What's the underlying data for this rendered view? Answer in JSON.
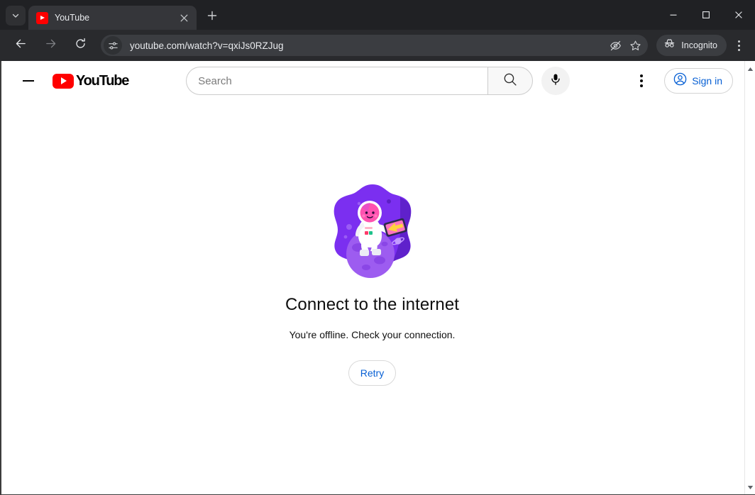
{
  "browser": {
    "tab_search_icon": "chevron-down-icon",
    "tabs": [
      {
        "title": "YouTube",
        "favicon": "youtube-favicon",
        "close_icon": "close-icon",
        "active": true
      }
    ],
    "new_tab_label": "+",
    "window_controls": {
      "minimize": "minimize-icon",
      "maximize": "maximize-icon",
      "close": "close-icon"
    },
    "toolbar": {
      "back_icon": "back-arrow-icon",
      "forward_icon": "forward-arrow-icon",
      "reload_icon": "reload-icon",
      "site_settings_icon": "tune-sliders-icon",
      "url": "youtube.com/watch?v=qxiJs0RZJug",
      "tracking_protection_icon": "eye-slash-icon",
      "bookmark_icon": "star-icon",
      "incognito_label": "Incognito",
      "incognito_icon": "incognito-hat-icon",
      "menu_icon": "three-dots-vertical-icon"
    },
    "colors": {
      "tabstrip_bg": "#202124",
      "active_tab_bg": "#35363a",
      "toolbar_bg": "#292a2d",
      "omnibox_bg": "#3b3d41",
      "toolbar_text": "#e8eaed"
    }
  },
  "youtube": {
    "header": {
      "menu_icon": "hamburger-menu-icon",
      "logo_text": "YouTube",
      "logo_icon": "youtube-play-icon",
      "search_placeholder": "Search",
      "search_value": "",
      "search_icon": "search-icon",
      "mic_icon": "microphone-icon",
      "settings_icon": "three-dots-vertical-icon",
      "sign_in_label": "Sign in",
      "sign_in_icon": "account-circle-icon"
    },
    "offline": {
      "illustration": "astronaut-on-planet-illustration",
      "title": "Connect to the internet",
      "subtitle": "You're offline. Check your connection.",
      "retry_label": "Retry"
    },
    "colors": {
      "brand_red": "#ff0000",
      "link_blue": "#065fd4",
      "text_primary": "#0f0f0f",
      "page_bg": "#ffffff"
    }
  },
  "scrollbar": {
    "up_arrow_icon": "scroll-up-arrow-icon",
    "down_arrow_icon": "scroll-down-arrow-icon"
  }
}
